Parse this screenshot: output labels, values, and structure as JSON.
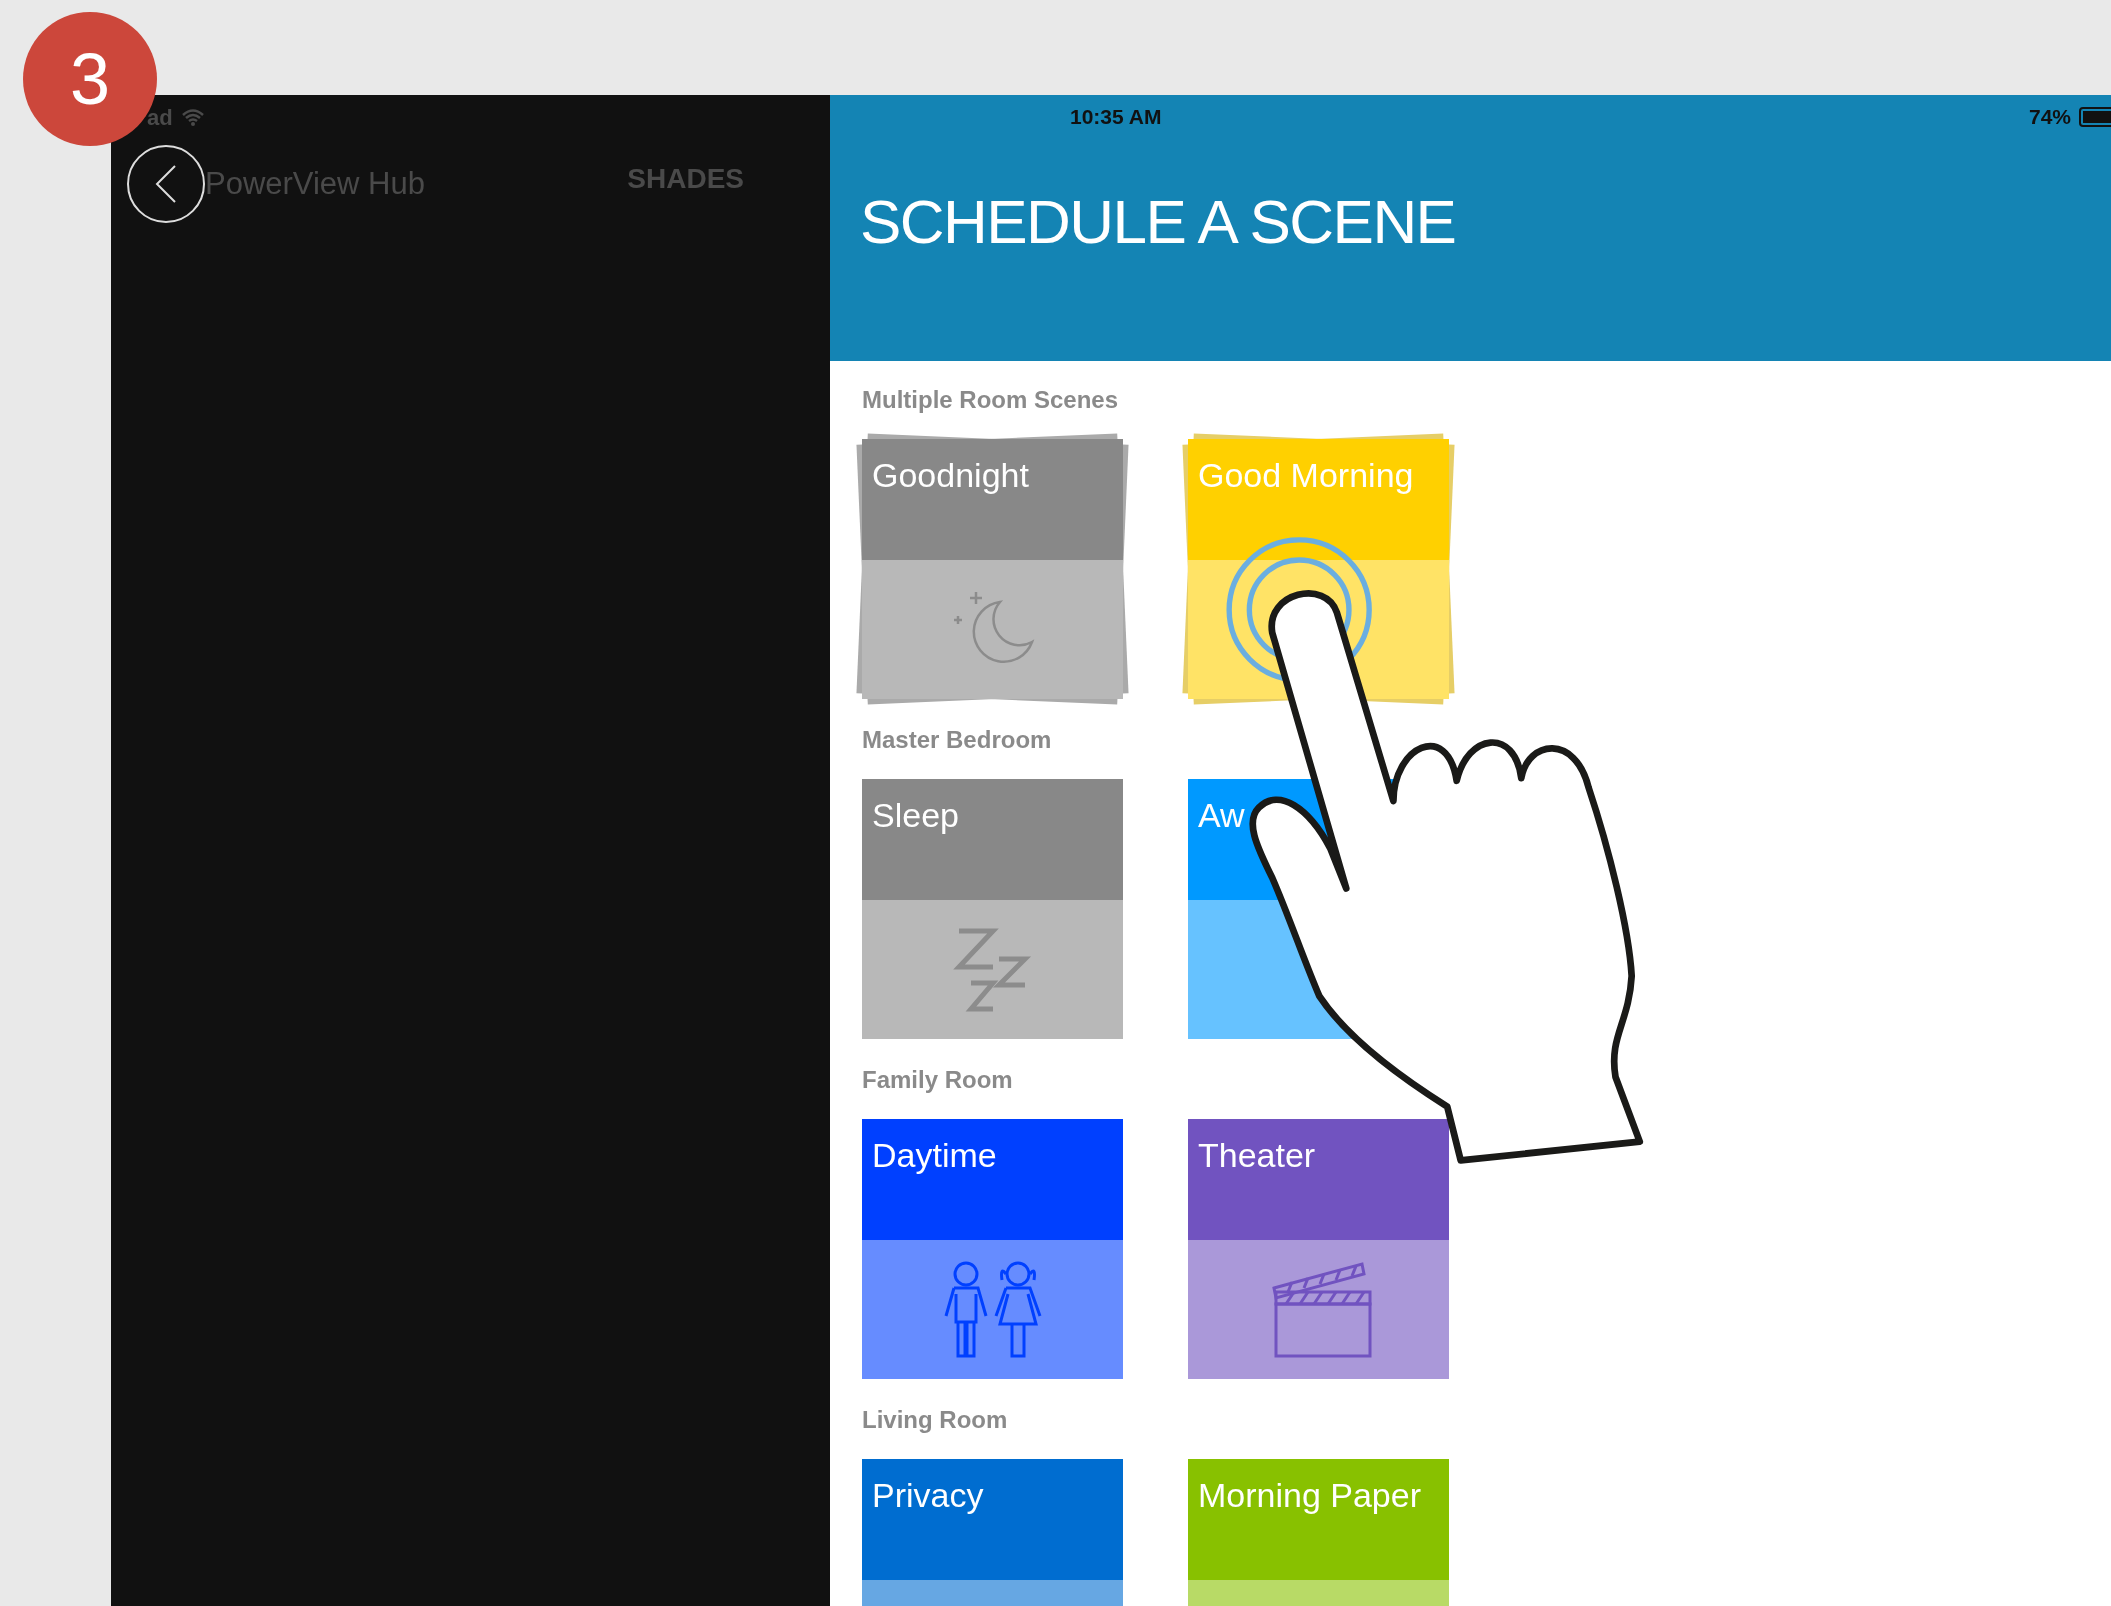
{
  "step_badge": "3",
  "left_panel": {
    "status_carrier": "ad",
    "app_title": "PowerView Hub",
    "tab_label": "SHADES"
  },
  "status_bar": {
    "time": "10:35 AM",
    "battery": "74%"
  },
  "title": "SCHEDULE A SCENE",
  "sections": [
    {
      "label": "Multiple Room Scenes",
      "kind": "stacked",
      "tiles": [
        {
          "name": "Goodnight",
          "color": "#888888"
        },
        {
          "name": "Good Morning",
          "color": "#ffd000"
        }
      ]
    },
    {
      "label": "Master Bedroom",
      "kind": "single",
      "tiles": [
        {
          "name": "Sleep",
          "color": "#888888"
        },
        {
          "name": "Aw",
          "color": "#0099ff"
        }
      ]
    },
    {
      "label": "Family Room",
      "kind": "single",
      "tiles": [
        {
          "name": "Daytime",
          "color": "#0040ff"
        },
        {
          "name": "Theater",
          "color": "#7153c0"
        }
      ]
    },
    {
      "label": "Living Room",
      "kind": "single",
      "tiles": [
        {
          "name": "Privacy",
          "color": "#006dd0"
        },
        {
          "name": "Morning Paper",
          "color": "#88c100"
        }
      ]
    }
  ]
}
